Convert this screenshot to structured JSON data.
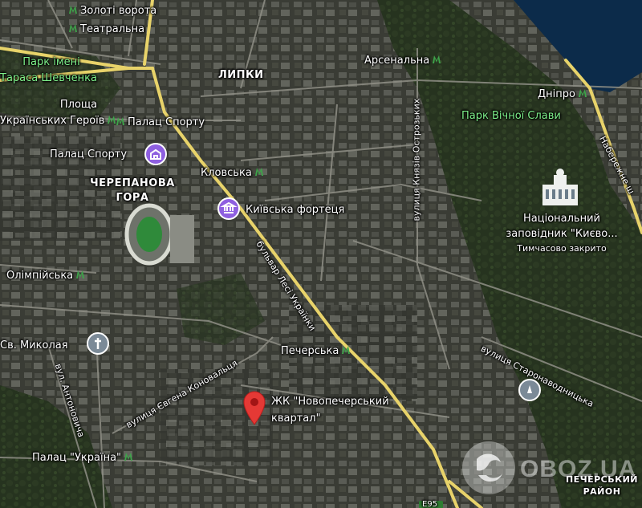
{
  "map": {
    "labels": {
      "zoloti_vorota": "Золоті ворота",
      "teatralna": "Театральна",
      "park_shevchenka_1": "Парк імені",
      "park_shevchenka_2": "Тараса Шевченка",
      "lypky": "ЛИПКИ",
      "arsenalna": "Арсенальна",
      "dnipro": "Дніпро",
      "naberezhne": "Набережне ш",
      "ploshcha_1": "Площа",
      "ploshcha_2": "Українських Героїв",
      "palats_sportu_metro": "Палац Спорту",
      "park_vichnoi_slavy": "Парк Вічної Слави",
      "palats_sportu": "Палац Спорту",
      "klovska": "Кловська",
      "cherepanova_1": "ЧЕРЕПАНОВА",
      "cherepanova_2": "ГОРА",
      "kyivska_fortetsia": "Київська фортеця",
      "kniaziv_ostrozkykh": "вулиця Князів Острозьких",
      "zapovidnyk_1": "Національний",
      "zapovidnyk_2": "заповідник \"Києво...",
      "zapovidnyk_status": "Тимчасово закрито",
      "lesi_ukrainky": "бульвар Лесі Українки",
      "olimpiiska": "Олімпійська",
      "pecherska": "Печерська",
      "sv_mykolaia": "Св. Миколая",
      "staronavodnytska": "вулиця Старонаводницька",
      "antonovycha": "вул. Антоновича",
      "konovaltsia": "вулиця Євгена Коновальця",
      "zhk_1": "ЖК \"Новопечерський",
      "zhk_2": "квартал\"",
      "palats_ukraina": "Палац \"Україна\"",
      "pecherskyi_1": "ПЕЧЕРСЬКИЙ",
      "pecherskyi_2": "РАЙОН",
      "e95": "E95"
    },
    "watermark": "OBOZ.UA",
    "colors": {
      "metro": "#3ea34a",
      "pin": "#e53935",
      "major_road": "#e8d36a",
      "water": "#0c2b4a",
      "poi_purple": "#8e5fe0"
    }
  }
}
